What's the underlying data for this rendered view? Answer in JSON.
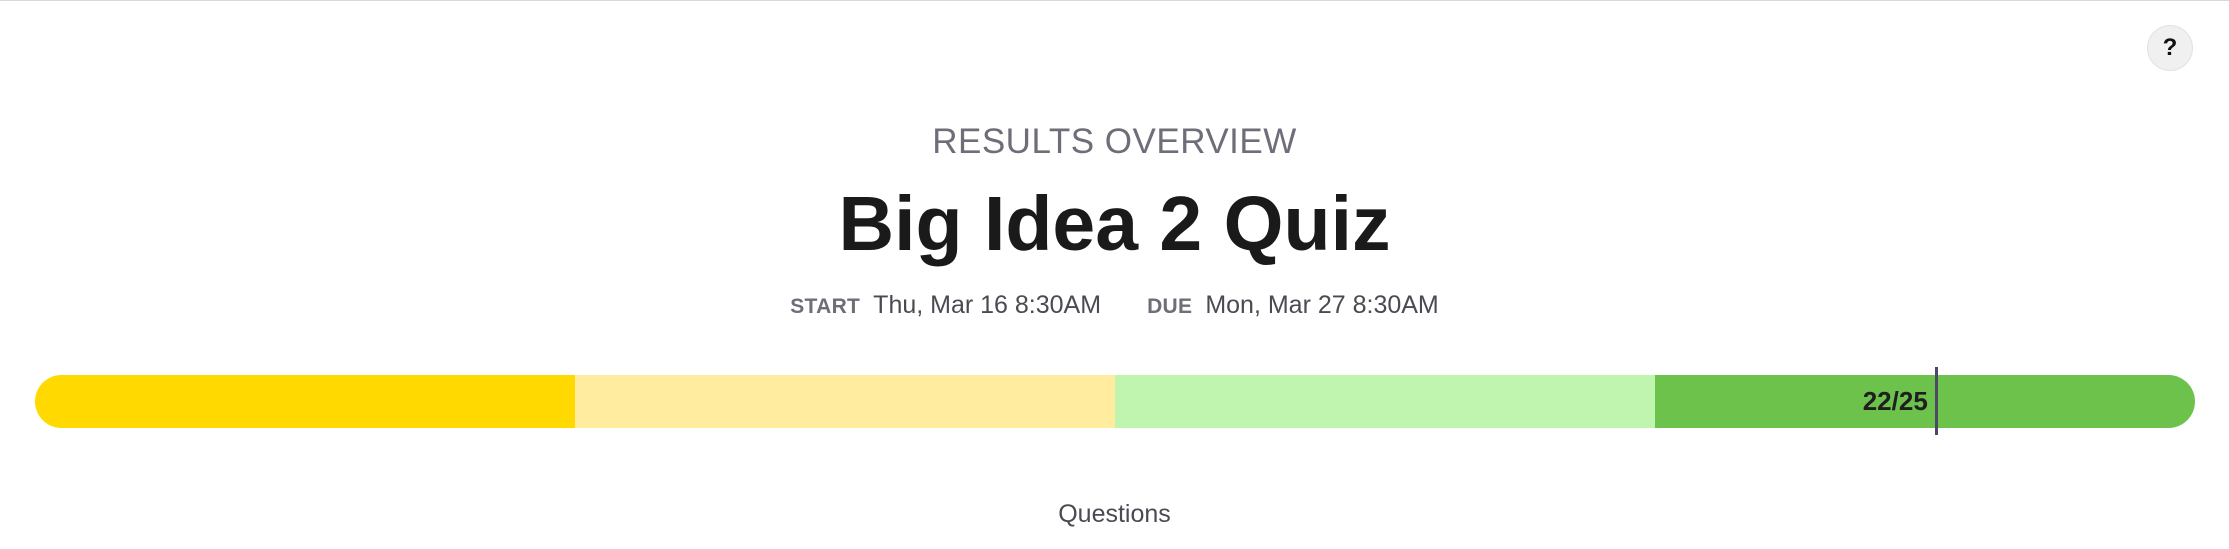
{
  "help": {
    "label": "?"
  },
  "header": {
    "eyebrow": "RESULTS OVERVIEW",
    "title": "Big Idea 2 Quiz"
  },
  "dates": {
    "start_label": "START",
    "start_value": "Thu, Mar 16 8:30AM",
    "due_label": "DUE",
    "due_value": "Mon, Mar 27 8:30AM"
  },
  "score": {
    "label": "22/25",
    "earned": 22,
    "total": 25,
    "segments": [
      {
        "name": "segment-1",
        "color": "#FFD900"
      },
      {
        "name": "segment-2",
        "color": "#FFEC9E"
      },
      {
        "name": "segment-3",
        "color": "#BFF5AE"
      },
      {
        "name": "segment-4",
        "color": "#6CC24A"
      }
    ]
  },
  "questions": {
    "label": "Questions"
  }
}
